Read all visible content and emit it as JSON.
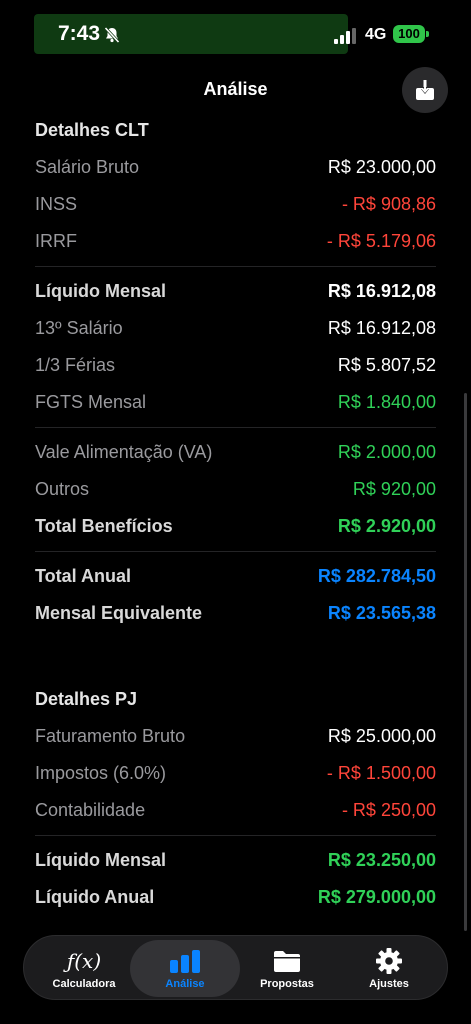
{
  "status": {
    "time": "7:43",
    "network": "4G",
    "battery": "100"
  },
  "header": {
    "title": "Análise"
  },
  "clt": {
    "title": "Detalhes CLT",
    "rows1": [
      {
        "label": "Salário Bruto",
        "value": "R$ 23.000,00"
      },
      {
        "label": "INSS",
        "value": "- R$ 908,86"
      },
      {
        "label": "IRRF",
        "value": "- R$ 5.179,06"
      }
    ],
    "rows2": [
      {
        "label": "Líquido Mensal",
        "value": "R$ 16.912,08"
      },
      {
        "label": "13º Salário",
        "value": "R$ 16.912,08"
      },
      {
        "label": "1/3 Férias",
        "value": "R$ 5.807,52"
      },
      {
        "label": "FGTS Mensal",
        "value": "R$ 1.840,00"
      }
    ],
    "rows3": [
      {
        "label": "Vale Alimentação (VA)",
        "value": "R$ 2.000,00"
      },
      {
        "label": "Outros",
        "value": "R$ 920,00"
      },
      {
        "label": "Total Benefícios",
        "value": "R$ 2.920,00"
      }
    ],
    "rows4": [
      {
        "label": "Total Anual",
        "value": "R$ 282.784,50"
      },
      {
        "label": "Mensal Equivalente",
        "value": "R$ 23.565,38"
      }
    ]
  },
  "pj": {
    "title": "Detalhes PJ",
    "rows1": [
      {
        "label": "Faturamento Bruto",
        "value": "R$ 25.000,00"
      },
      {
        "label": "Impostos (6.0%)",
        "value": "- R$ 1.500,00"
      },
      {
        "label": "Contabilidade",
        "value": "- R$ 250,00"
      }
    ],
    "rows2": [
      {
        "label": "Líquido Mensal",
        "value": "R$ 23.250,00"
      },
      {
        "label": "Líquido Anual",
        "value": "R$ 279.000,00"
      }
    ]
  },
  "tabs": [
    {
      "label": "Calculadora",
      "icon": "function-icon"
    },
    {
      "label": "Análise",
      "icon": "bar-chart-icon"
    },
    {
      "label": "Propostas",
      "icon": "folder-icon"
    },
    {
      "label": "Ajustes",
      "icon": "gear-icon"
    }
  ],
  "colors": {
    "red": "#ff453a",
    "green": "#30d158",
    "blue": "#0a84ff",
    "accent": "#0a84ff"
  }
}
